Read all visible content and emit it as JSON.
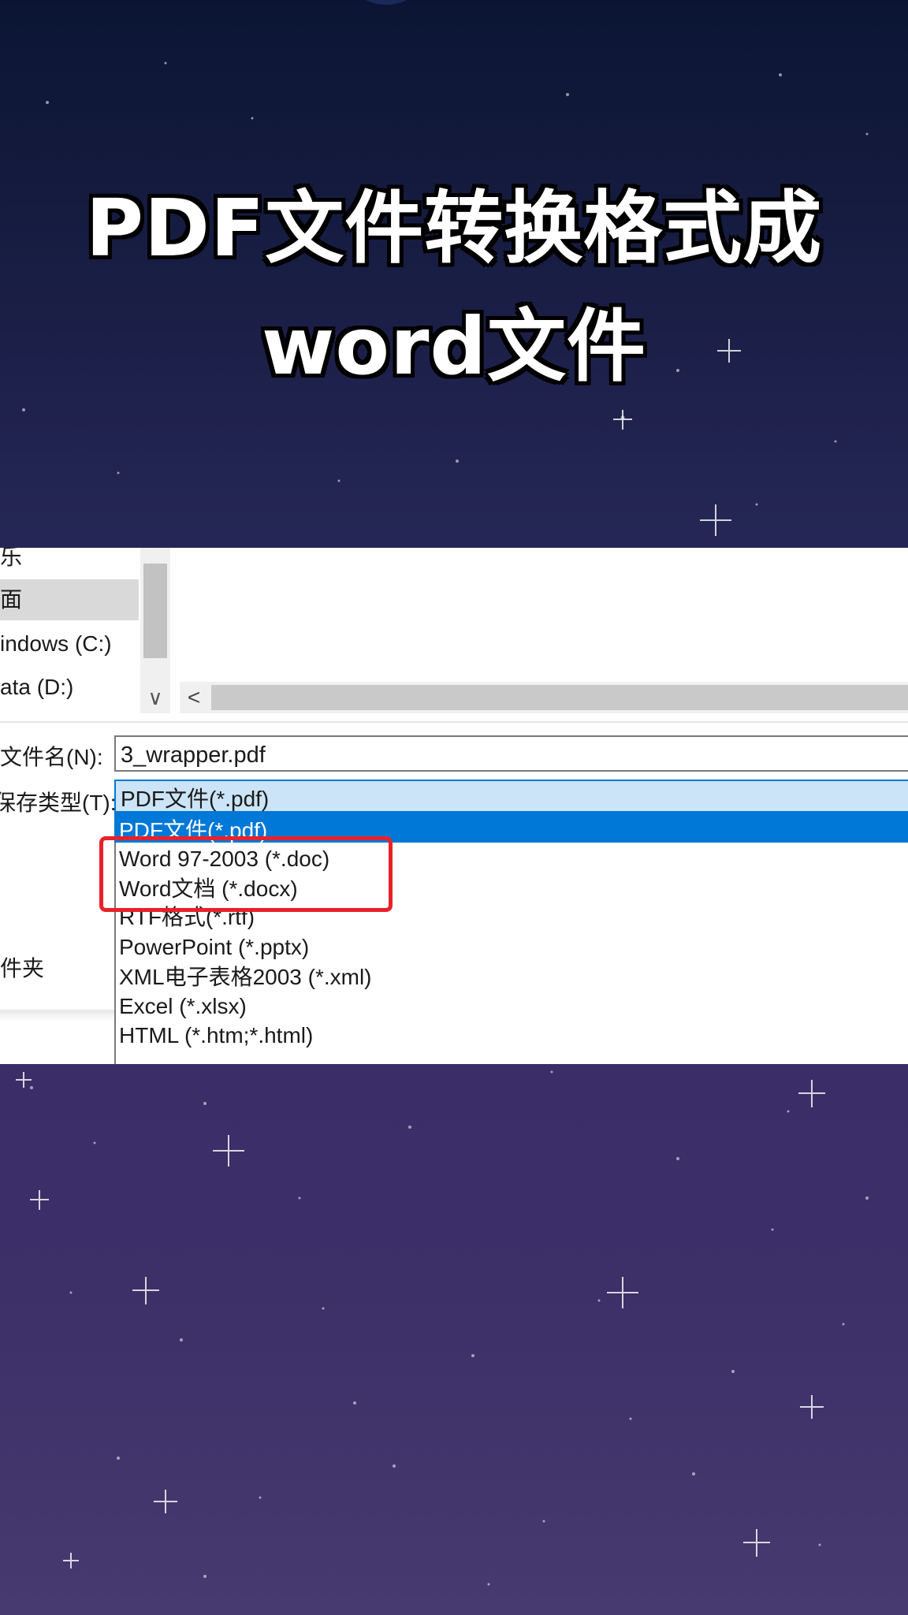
{
  "headline": {
    "line1": "PDF文件转换格式成",
    "line2": "word文件"
  },
  "nav": {
    "items": [
      {
        "label": "乐",
        "selected": false
      },
      {
        "label": "面",
        "selected": true
      },
      {
        "label": "indows (C:)",
        "selected": false
      },
      {
        "label": "ata (D:)",
        "selected": false
      }
    ],
    "scroll_down_glyph": "∨",
    "scroll_left_glyph": "<"
  },
  "form": {
    "filename_label": "文件名(N):",
    "filename_value": "3_wrapper.pdf",
    "filetype_label": "保存类型(T):",
    "filetype_value": "PDF文件(*.pdf)",
    "folder_label": "件夹"
  },
  "dropdown": {
    "options": [
      "PDF文件(*.pdf)",
      "Word 97-2003 (*.doc)",
      "Word文档 (*.docx)",
      "RTF格式(*.rtf)",
      "PowerPoint (*.pptx)",
      "XML电子表格2003 (*.xml)",
      "Excel (*.xlsx)",
      "HTML (*.htm;*.html)"
    ],
    "highlighted_index": 0
  },
  "colors": {
    "accent": "#0078d7",
    "selected_field": "#cce4f7",
    "annotation": "#e8212a"
  }
}
